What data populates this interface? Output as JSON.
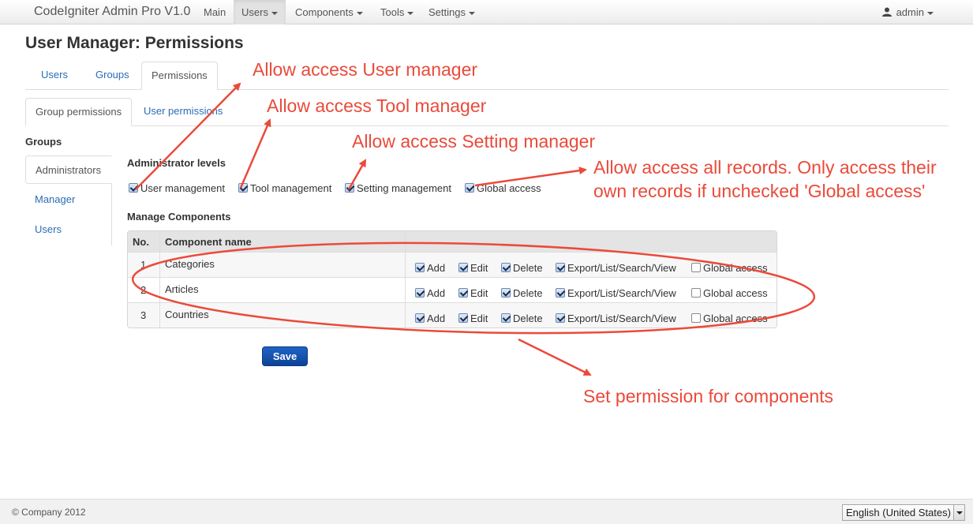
{
  "app": {
    "title": "CodeIgniter Admin Pro V1.0"
  },
  "nav": {
    "items": [
      {
        "label": "Main",
        "dropdown": false,
        "active": false
      },
      {
        "label": "Users",
        "dropdown": true,
        "active": true
      },
      {
        "label": "Components",
        "dropdown": true,
        "active": false
      },
      {
        "label": "Tools",
        "dropdown": true,
        "active": false
      },
      {
        "label": "Settings",
        "dropdown": true,
        "active": false
      }
    ],
    "user": {
      "name": "admin",
      "icon": "user-icon"
    }
  },
  "page": {
    "title": "User Manager: Permissions"
  },
  "main_tabs": [
    {
      "label": "Users",
      "active": false
    },
    {
      "label": "Groups",
      "active": false
    },
    {
      "label": "Permissions",
      "active": true
    }
  ],
  "sub_tabs": [
    {
      "label": "Group permissions",
      "active": true
    },
    {
      "label": "User permissions",
      "active": false
    }
  ],
  "groups": {
    "title": "Groups",
    "items": [
      {
        "label": "Administrators",
        "active": true
      },
      {
        "label": "Manager",
        "active": false
      },
      {
        "label": "Users",
        "active": false
      }
    ]
  },
  "admin_levels": {
    "title": "Administrator levels",
    "options": [
      {
        "label": "User management",
        "checked": true
      },
      {
        "label": "Tool management",
        "checked": true
      },
      {
        "label": "Setting management",
        "checked": true
      },
      {
        "label": "Global access",
        "checked": true
      }
    ]
  },
  "components": {
    "title": "Manage Components",
    "headers": {
      "no": "No.",
      "name": "Component name"
    },
    "permission_labels": [
      "Add",
      "Edit",
      "Delete",
      "Export/List/Search/View",
      "Global access"
    ],
    "rows": [
      {
        "no": "1",
        "name": "Categories",
        "perms": [
          true,
          true,
          true,
          true,
          false
        ]
      },
      {
        "no": "2",
        "name": "Articles",
        "perms": [
          true,
          true,
          true,
          true,
          false
        ]
      },
      {
        "no": "3",
        "name": "Countries",
        "perms": [
          true,
          true,
          true,
          true,
          false
        ]
      }
    ]
  },
  "save_label": "Save",
  "annotations": {
    "user_manager": "Allow access User manager",
    "tool_manager": "Allow access Tool manager",
    "setting_manager": "Allow access Setting manager",
    "all_records_line1": "Allow access all records. Only access their",
    "all_records_line2": "own records if unchecked 'Global access'",
    "components": "Set permission for components",
    "color": "#ea4a3a"
  },
  "footer": {
    "copyright": "© Company 2012",
    "language": "English (United States)"
  },
  "colors": {
    "link": "#2a6db5",
    "primary_button": "#1a56b0",
    "annotation": "#ea4a3a"
  }
}
